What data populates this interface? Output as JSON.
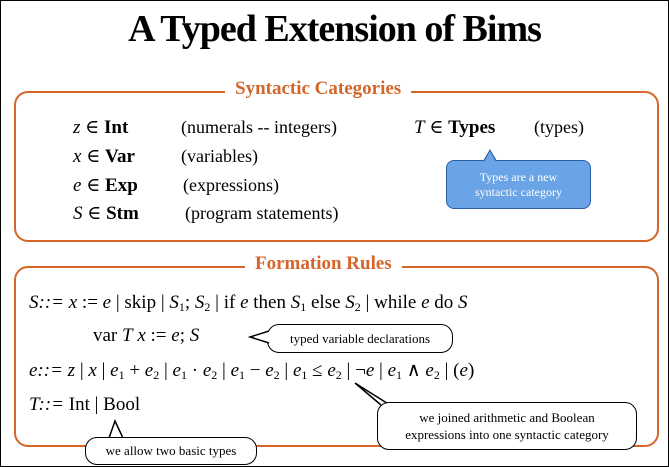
{
  "title": "A Typed Extension of Bims",
  "syntactic": {
    "heading": "Syntactic Categories",
    "rows": [
      {
        "var": "z",
        "elem": "∈",
        "set": "Int",
        "desc": "(numerals -- integers)"
      },
      {
        "var": "x",
        "elem": "∈",
        "set": "Var",
        "desc": "(variables)"
      },
      {
        "var": "e",
        "elem": "∈",
        "set": "Exp",
        "desc": "(expressions)"
      },
      {
        "var": "S",
        "elem": "∈",
        "set": "Stm",
        "desc": "(program statements)"
      }
    ],
    "types_row": {
      "var": "T",
      "elem": "∈",
      "set": "Types",
      "desc": "(types)"
    },
    "callout_line1": "Types are a new",
    "callout_line2": "syntactic category"
  },
  "formation": {
    "heading": "Formation Rules",
    "stm_lhs": "S::=",
    "exp_lhs": "e::=",
    "type_lhs": "T::=",
    "type_rhs": "Int | Bool",
    "callouts": {
      "typed_decl": "typed variable declarations",
      "joined_line1": "we joined arithmetic and Boolean",
      "joined_line2": "expressions into one syntactic category",
      "basic_types": "we allow two basic types"
    }
  },
  "colors": {
    "accent": "#d4662a",
    "callout_blue": "#6aa4e6"
  }
}
